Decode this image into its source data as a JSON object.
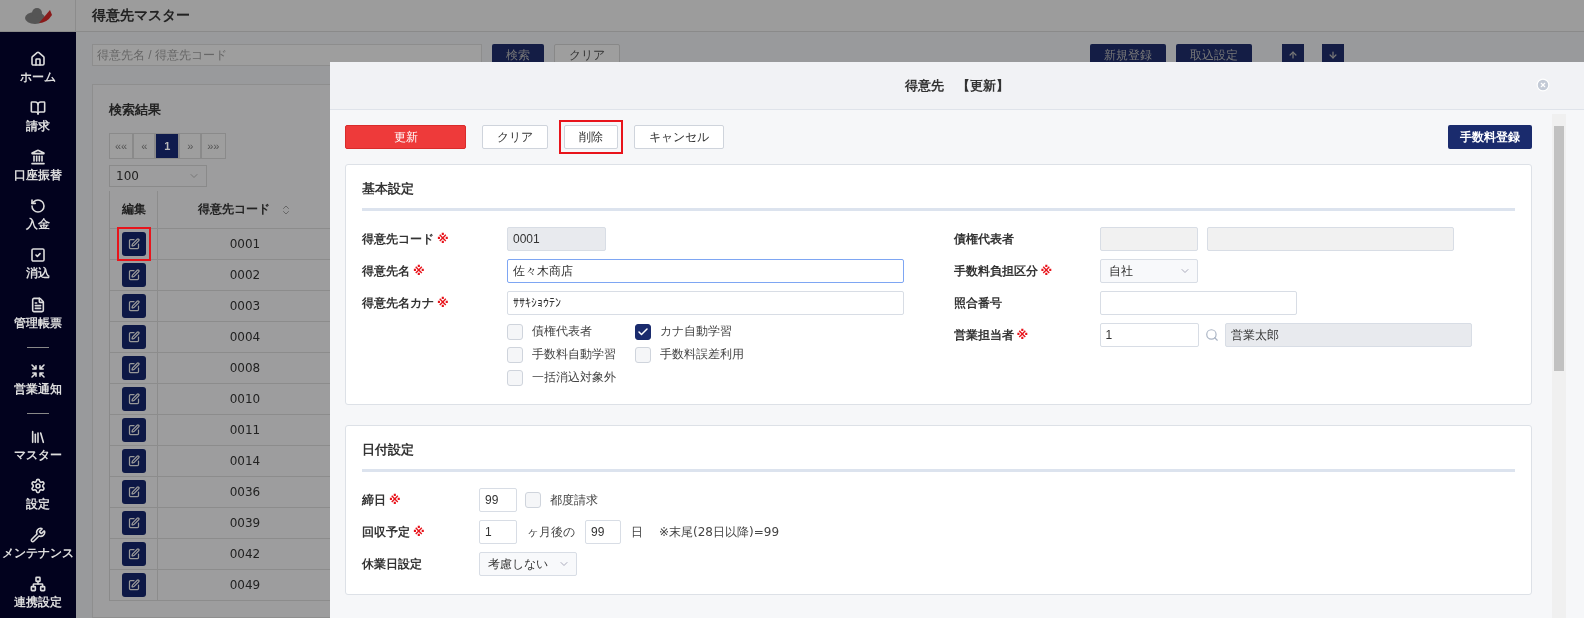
{
  "header": {
    "title": "得意先マスター"
  },
  "sidebar": {
    "items": [
      {
        "kind": "item",
        "label": "ホーム"
      },
      {
        "kind": "item",
        "label": "請求"
      },
      {
        "kind": "item",
        "label": "口座振替"
      },
      {
        "kind": "item",
        "label": "入金"
      },
      {
        "kind": "item",
        "label": "消込"
      },
      {
        "kind": "item",
        "label": "管理帳票"
      },
      {
        "kind": "divider"
      },
      {
        "kind": "item",
        "label": "営業通知"
      },
      {
        "kind": "divider"
      },
      {
        "kind": "item",
        "label": "マスター"
      },
      {
        "kind": "item",
        "label": "設定"
      },
      {
        "kind": "item",
        "label": "メンテナンス"
      },
      {
        "kind": "item",
        "label": "連携設定"
      }
    ]
  },
  "toolbar": {
    "search_placeholder": "得意先名 / 得意先コード",
    "left_buttons": [
      "検索",
      "クリア"
    ],
    "right_buttons": [
      "新規登録",
      "取込設定"
    ]
  },
  "results": {
    "title": "検索結果",
    "pager": [
      {
        "label": "««",
        "selected": false
      },
      {
        "label": "«",
        "selected": false
      },
      {
        "label": "1",
        "selected": true
      },
      {
        "label": "»",
        "selected": false
      },
      {
        "label": "»»",
        "selected": false
      }
    ],
    "page_size": "100",
    "columns": [
      "編集",
      "得意先コード"
    ],
    "rows": [
      {
        "code": "0001",
        "highlighted": true
      },
      {
        "code": "0002",
        "highlighted": false
      },
      {
        "code": "0003",
        "highlighted": false
      },
      {
        "code": "0004",
        "highlighted": false
      },
      {
        "code": "0008",
        "highlighted": false
      },
      {
        "code": "0010",
        "highlighted": false
      },
      {
        "code": "0011",
        "highlighted": false
      },
      {
        "code": "0014",
        "highlighted": false
      },
      {
        "code": "0036",
        "highlighted": false
      },
      {
        "code": "0039",
        "highlighted": false
      },
      {
        "code": "0042",
        "highlighted": false
      },
      {
        "code": "0049",
        "highlighted": false
      }
    ]
  },
  "dialog": {
    "title": "得意先　【更新】",
    "buttons": [
      {
        "kind": "primary",
        "label": "更新",
        "highlighted": false
      },
      {
        "kind": "default",
        "label": "クリア",
        "highlighted": false
      },
      {
        "kind": "default",
        "label": "削除",
        "highlighted": true
      },
      {
        "kind": "default",
        "label": "キャンセル",
        "highlighted": false
      }
    ],
    "fee_button": "手数料登録",
    "basic": {
      "title": "基本設定",
      "left_fields": [
        {
          "label": "得意先コード",
          "mark": "※",
          "kind": "readonly",
          "value": "0001"
        },
        {
          "label": "得意先名",
          "mark": "※",
          "kind": "focused",
          "value": "佐々木商店"
        },
        {
          "label": "得意先名カナ",
          "mark": "※",
          "kind": "text",
          "value": "ｻｻｷｼｮｳﾃﾝ"
        }
      ],
      "checkboxes": [
        {
          "label": "債権代表者",
          "checked": false
        },
        {
          "label": "カナ自動学習",
          "checked": true
        },
        {
          "label": "手数料自動学習",
          "checked": false
        },
        {
          "label": "手数料誤差利用",
          "checked": false
        },
        {
          "label": "一括消込対象外",
          "checked": false
        }
      ],
      "right_fields": [
        {
          "label": "債権代表者",
          "kind": "pair"
        },
        {
          "label": "手数料負担区分",
          "mark": "※",
          "kind": "select",
          "value": "自社"
        },
        {
          "label": "照合番号",
          "kind": "text"
        },
        {
          "label": "営業担当者",
          "mark": "※",
          "kind": "lookup",
          "value": "1",
          "name": "営業太郎"
        }
      ]
    },
    "dates": {
      "title": "日付設定",
      "closing": {
        "label": "締日",
        "mark": "※",
        "value": "99",
        "checkbox": {
          "label": "都度請求",
          "checked": false
        }
      },
      "collection": {
        "label": "回収予定",
        "mark": "※",
        "months": "1",
        "months_suffix": "ヶ月後の",
        "day": "99",
        "day_suffix": "日",
        "note": "※末尾(28日以降)=99"
      },
      "holiday": {
        "label": "休業日設定",
        "value": "考慮しない"
      }
    }
  }
}
